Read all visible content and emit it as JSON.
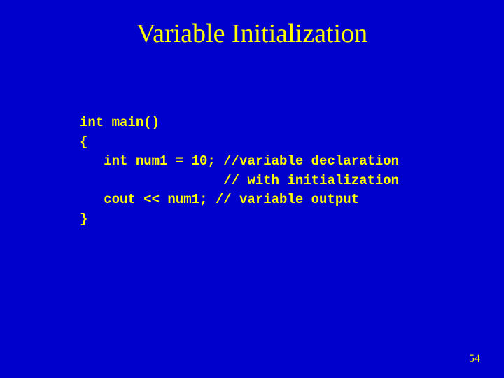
{
  "slide": {
    "title": "Variable Initialization",
    "page_number": "54"
  },
  "code": {
    "line1": "int main()",
    "line2": "{",
    "line3": "   int num1 = 10; //variable declaration",
    "line4": "                  // with initialization",
    "line5": "   cout << num1; // variable output",
    "line6": "}"
  }
}
